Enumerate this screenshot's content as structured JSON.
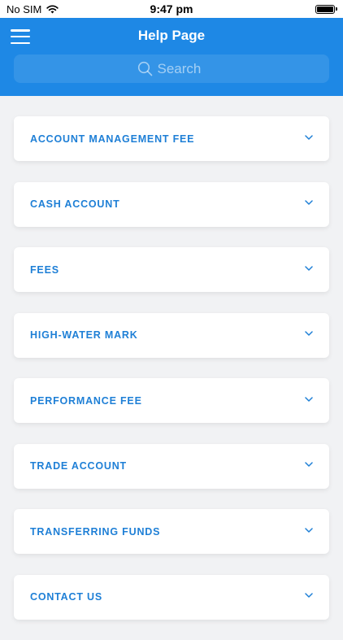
{
  "status": {
    "carrier": "No SIM",
    "time": "9:47 pm",
    "battery_level": 1.0
  },
  "header": {
    "title": "Help Page",
    "search_placeholder": "Search"
  },
  "items": [
    {
      "label": "ACCOUNT MANAGEMENT FEE"
    },
    {
      "label": "CASH ACCOUNT"
    },
    {
      "label": "FEES"
    },
    {
      "label": "HIGH-WATER MARK"
    },
    {
      "label": "PERFORMANCE FEE"
    },
    {
      "label": "TRADE ACCOUNT"
    },
    {
      "label": "TRANSFERRING FUNDS"
    },
    {
      "label": "CONTACT US"
    }
  ],
  "colors": {
    "primary": "#1e88e5",
    "accent_text": "#1e7fd6",
    "background": "#f1f2f4"
  }
}
